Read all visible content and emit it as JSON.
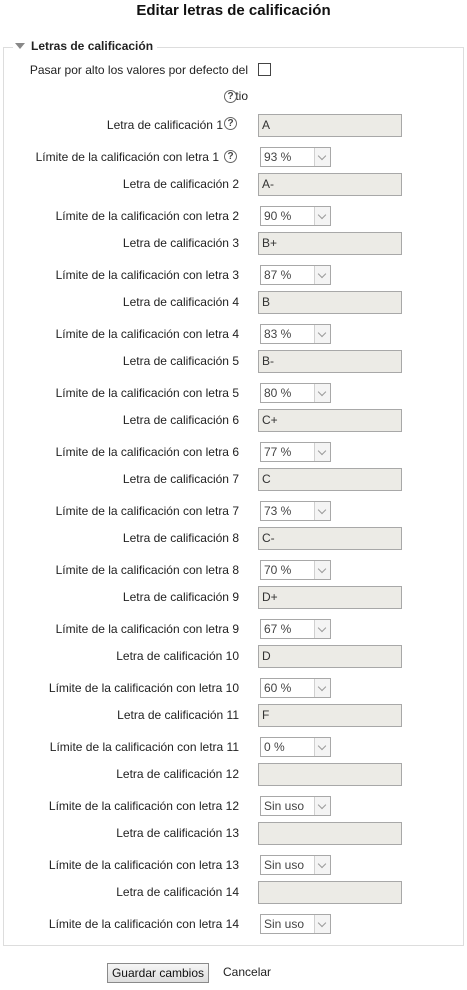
{
  "page_title": "Editar letras de calificación",
  "section": {
    "legend": "Letras de calificación"
  },
  "override": {
    "label_line1": "Pasar por alto los valores por defecto del",
    "label_line2": "sitio",
    "checked": false
  },
  "help_icon": "help-icon",
  "rows": [
    {
      "letter_label": "Letra de calificación 1",
      "letter_value": "A",
      "boundary_label": "Límite de la calificación con letra 1",
      "boundary_value": "93 %"
    },
    {
      "letter_label": "Letra de calificación 2",
      "letter_value": "A-",
      "boundary_label": "Límite de la calificación con letra 2",
      "boundary_value": "90 %"
    },
    {
      "letter_label": "Letra de calificación 3",
      "letter_value": "B+",
      "boundary_label": "Límite de la calificación con letra 3",
      "boundary_value": "87 %"
    },
    {
      "letter_label": "Letra de calificación 4",
      "letter_value": "B",
      "boundary_label": "Límite de la calificación con letra 4",
      "boundary_value": "83 %"
    },
    {
      "letter_label": "Letra de calificación 5",
      "letter_value": "B-",
      "boundary_label": "Límite de la calificación con letra 5",
      "boundary_value": "80 %"
    },
    {
      "letter_label": "Letra de calificación 6",
      "letter_value": "C+",
      "boundary_label": "Límite de la calificación con letra 6",
      "boundary_value": "77 %"
    },
    {
      "letter_label": "Letra de calificación 7",
      "letter_value": "C",
      "boundary_label": "Límite de la calificación con letra 7",
      "boundary_value": "73 %"
    },
    {
      "letter_label": "Letra de calificación 8",
      "letter_value": "C-",
      "boundary_label": "Límite de la calificación con letra 8",
      "boundary_value": "70 %"
    },
    {
      "letter_label": "Letra de calificación 9",
      "letter_value": "D+",
      "boundary_label": "Límite de la calificación con letra 9",
      "boundary_value": "67 %"
    },
    {
      "letter_label": "Letra de calificación 10",
      "letter_value": "D",
      "boundary_label": "Límite de la calificación con letra 10",
      "boundary_value": "60 %"
    },
    {
      "letter_label": "Letra de calificación 11",
      "letter_value": "F",
      "boundary_label": "Límite de la calificación con letra 11",
      "boundary_value": "0 %"
    },
    {
      "letter_label": "Letra de calificación 12",
      "letter_value": "",
      "boundary_label": "Límite de la calificación con letra 12",
      "boundary_value": "Sin uso"
    },
    {
      "letter_label": "Letra de calificación 13",
      "letter_value": "",
      "boundary_label": "Límite de la calificación con letra 13",
      "boundary_value": "Sin uso"
    },
    {
      "letter_label": "Letra de calificación 14",
      "letter_value": "",
      "boundary_label": "Límite de la calificación con letra 14",
      "boundary_value": "Sin uso"
    }
  ],
  "buttons": {
    "save": "Guardar cambios",
    "cancel": "Cancelar"
  },
  "colors": {
    "input_background": "#ecebe6",
    "border": "#a8a8a8"
  }
}
